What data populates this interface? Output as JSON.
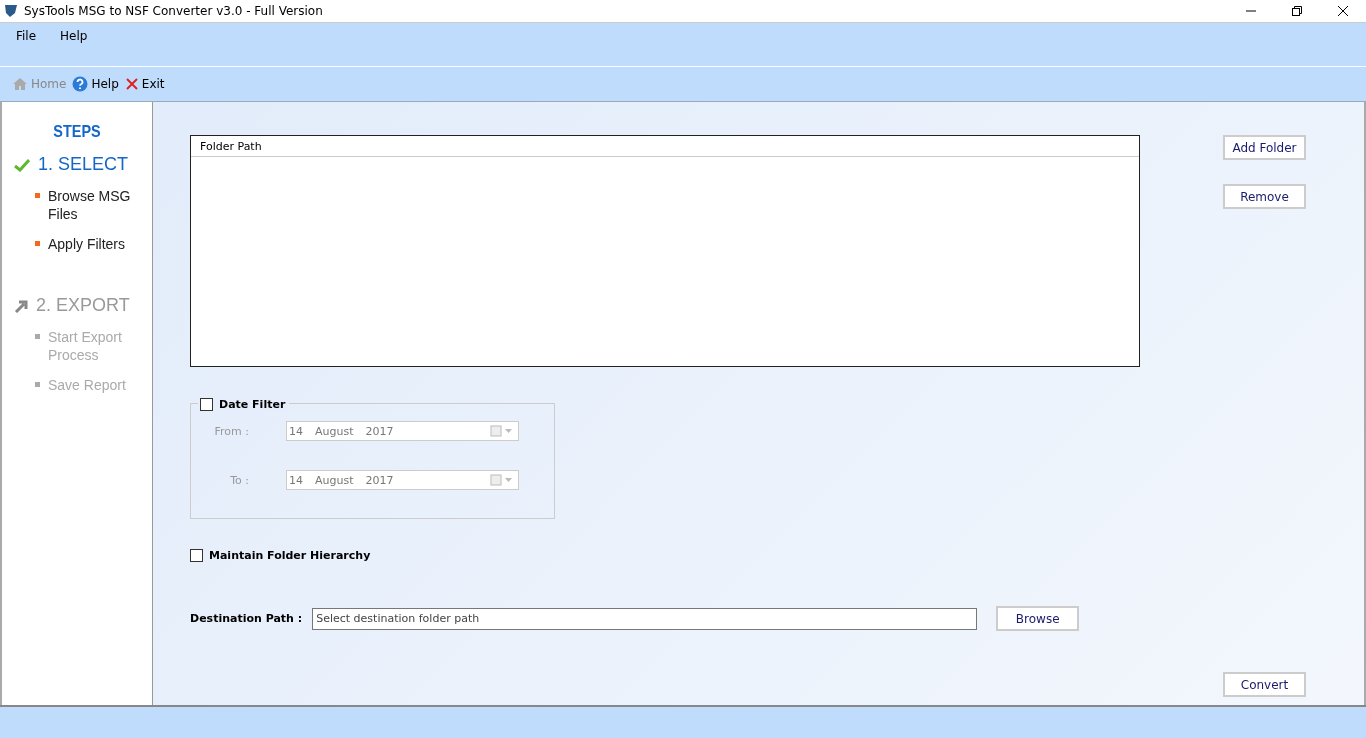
{
  "window": {
    "title": "SysTools MSG to NSF Converter v3.0 - Full Version"
  },
  "menu": [
    "File",
    "Help"
  ],
  "toolbar": [
    {
      "label": "Home",
      "kind": "home",
      "disabled": true
    },
    {
      "label": "Help",
      "kind": "help",
      "disabled": false
    },
    {
      "label": "Exit",
      "kind": "exit",
      "disabled": false
    }
  ],
  "sidebar": {
    "title": "STEPS",
    "steps": [
      {
        "label": "1. SELECT",
        "kind": "check",
        "active": true,
        "items": [
          "Browse MSG Files",
          "Apply Filters"
        ]
      },
      {
        "label": "2. EXPORT",
        "kind": "arrow",
        "active": false,
        "items": [
          "Start Export Process",
          "Save Report"
        ]
      }
    ]
  },
  "folder_table": {
    "columns": [
      "Folder Path"
    ]
  },
  "side_buttons": [
    "Add Folder",
    "Remove"
  ],
  "date_filter": {
    "label": "Date Filter",
    "checked": false,
    "fields": [
      {
        "label": "From :",
        "day": "14",
        "month": "August",
        "year": "2017"
      },
      {
        "label": "To :",
        "day": "14",
        "month": "August",
        "year": "2017"
      }
    ]
  },
  "hierarchy": {
    "label": "Maintain Folder Hierarchy",
    "checked": false
  },
  "destination": {
    "label": "Destination Path :",
    "placeholder": "Select destination folder path",
    "button": "Browse"
  },
  "convert_button": "Convert"
}
